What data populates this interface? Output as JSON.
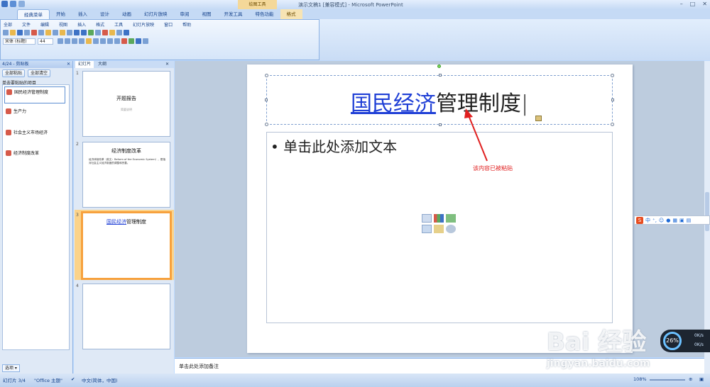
{
  "window": {
    "title": "演示文稿1 [兼容模式] - Microsoft PowerPoint",
    "contextual_tab_group": "绘图工具"
  },
  "ribbon_tabs": [
    "经典菜单",
    "开始",
    "插入",
    "设计",
    "动画",
    "幻灯片放映",
    "审阅",
    "视图",
    "开发工具",
    "特色功能",
    "格式"
  ],
  "classic_menu": [
    "全部",
    "文件",
    "编辑",
    "视图",
    "插入",
    "格式",
    "工具",
    "幻灯片放映",
    "窗口",
    "帮助"
  ],
  "font": {
    "name": "宋体 (标题)",
    "size": "44"
  },
  "clipboard": {
    "header": "4/24 - 剪贴板",
    "paste_all": "全部粘贴",
    "clear_all": "全部清空",
    "subtitle": "单击要粘贴的项目",
    "items": [
      "国民经济管理制度",
      "生产力",
      "社会主义市场经济",
      "经济制度改革"
    ],
    "options": "选项"
  },
  "slides_pane": {
    "tab_slides": "幻灯片",
    "tab_outline": "大纲",
    "thumbs": [
      {
        "num": "1",
        "title": "开题报告",
        "subtitle": "简要说明"
      },
      {
        "num": "2",
        "title": "经济制度改革",
        "body": "经济体制改革（英文：Reform of the Economic System），是指对社会主义经济制度的调整和完善。"
      },
      {
        "num": "3",
        "title_link": "国民经济",
        "title_rest": "管理制度"
      },
      {
        "num": "4"
      }
    ]
  },
  "slide": {
    "title_link": "国民经济",
    "title_rest": "管理制度",
    "body_placeholder": "单击此处添加文本",
    "annotation": "该内容已被粘贴"
  },
  "notes_placeholder": "单击此处添加备注",
  "ime": {
    "brand": "S",
    "mode": "中"
  },
  "gauge": {
    "percent": "26%",
    "r1": "0K/s",
    "r2": "0K/s"
  },
  "status": {
    "slide_info": "幻灯片 3/4",
    "theme": "\"Office 主题\"",
    "language": "中文(简体，中国)",
    "zoom": "108%"
  },
  "watermark": {
    "brand": "Bai 经验",
    "url": "jingyan.baidu.com"
  }
}
